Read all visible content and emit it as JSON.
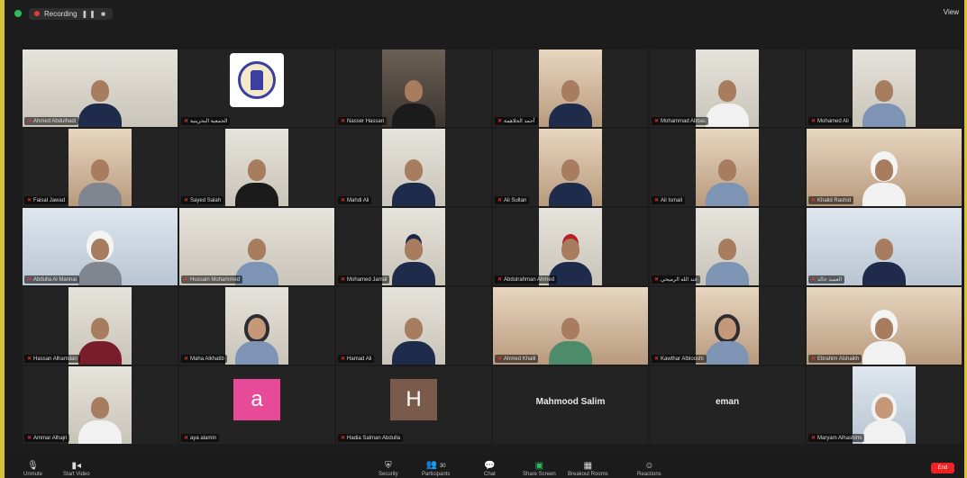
{
  "recording": {
    "label": "Recording",
    "controls": "❚❚ ■"
  },
  "view_label": "View",
  "participants": [
    {
      "name": "Ahmed Abdulhadi",
      "style": "person navy",
      "bg": "video wide"
    },
    {
      "name": "الجمعية البحرينية",
      "style": "logo",
      "bg": ""
    },
    {
      "name": "Nasser Hassan",
      "style": "person black",
      "bg": "video dark"
    },
    {
      "name": "أحمد الجلاهمة",
      "style": "person navy",
      "bg": "video warm"
    },
    {
      "name": "Mohammad Abbas",
      "style": "person white",
      "bg": "video"
    },
    {
      "name": "Mohamed Ali",
      "style": "person blue",
      "bg": "video"
    },
    {
      "name": "Faisal Jawad",
      "style": "person gray",
      "bg": "video warm"
    },
    {
      "name": "Sayed Salah",
      "style": "person black",
      "bg": "video"
    },
    {
      "name": "Mahdi Ali",
      "style": "person navy",
      "bg": "video"
    },
    {
      "name": "Ali Sultan",
      "style": "person navy",
      "bg": "video warm"
    },
    {
      "name": "Ali Ismail",
      "style": "person blue",
      "bg": "video warm"
    },
    {
      "name": "Khalid Rashid",
      "style": "person ghutra white",
      "bg": "video wide warm"
    },
    {
      "name": "Abdulla Al Mannai",
      "style": "person ghutra gray",
      "bg": "video wide cool"
    },
    {
      "name": "Hussain Mohammed",
      "style": "person blue",
      "bg": "video wide"
    },
    {
      "name": "Mohamed Jamal",
      "style": "person cap navy",
      "bg": "video"
    },
    {
      "name": "Abdulrahman Ahmed",
      "style": "person redcap navy",
      "bg": "video"
    },
    {
      "name": "عبد الله الرميحي",
      "style": "person blue",
      "bg": "video"
    },
    {
      "name": "العميد خالد",
      "style": "person navy",
      "bg": "video wide cool"
    },
    {
      "name": "Hassan Alhamdan",
      "style": "person red",
      "bg": "video"
    },
    {
      "name": "Maha Alkhatib",
      "style": "person hijab blue",
      "bg": "video"
    },
    {
      "name": "Hamad Ali",
      "style": "person navy",
      "bg": "video"
    },
    {
      "name": "Ahmed Khalil",
      "style": "person green",
      "bg": "video wide warm"
    },
    {
      "name": "Kawthar Alblooshi",
      "style": "person hijab blue",
      "bg": "video warm"
    },
    {
      "name": "Ebrahim Alshaikh",
      "style": "person ghutra white",
      "bg": "video wide warm"
    },
    {
      "name": "Ammar Alhajri",
      "style": "person white",
      "bg": "video"
    },
    {
      "name": "aya alamin",
      "style": "letter",
      "letter": "a",
      "color": "#e84a9a"
    },
    {
      "name": "Hadia Salman Abdulla",
      "style": "letter",
      "letter": "H",
      "color": "#7a5a4a"
    },
    {
      "name": "Mahmood Salim",
      "style": "text"
    },
    {
      "name": "eman",
      "style": "text"
    },
    {
      "name": "Maryam Alhashimi",
      "style": "person hijab-w white",
      "bg": "video cool"
    }
  ],
  "toolbar": {
    "unmute": "Unmute",
    "start_video": "Start Video",
    "security": "Security",
    "participants": "Participants",
    "participants_count": "30",
    "chat": "Chat",
    "share_screen": "Share Screen",
    "breakout": "Breakout Rooms",
    "reactions": "Reactions",
    "end": "End"
  }
}
